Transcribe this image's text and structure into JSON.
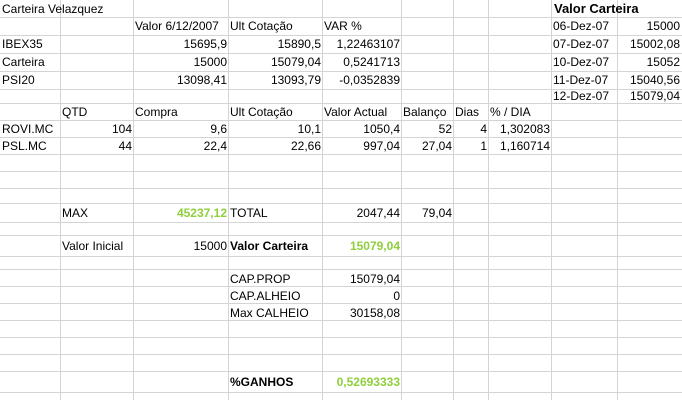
{
  "title": "Carteira Velazquez",
  "quotes": {
    "headers": [
      "Valor 6/12/2007",
      "Ult Cotação",
      "VAR %"
    ],
    "rows": [
      {
        "name": "IBEX35",
        "valor": "15695,9",
        "ult": "15890,5",
        "var": "1,22463107"
      },
      {
        "name": "Carteira",
        "valor": "15000",
        "ult": "15079,04",
        "var": "0,5241713"
      },
      {
        "name": "PSI20",
        "valor": "13098,41",
        "ult": "13093,79",
        "var": "-0,0352839"
      }
    ]
  },
  "valor_carteira_panel": {
    "title": "Valor Carteira",
    "rows": [
      {
        "date": "06-Dez-07",
        "value": "15000"
      },
      {
        "date": "07-Dez-07",
        "value": "15002,08"
      },
      {
        "date": "10-Dez-07",
        "value": "15052"
      },
      {
        "date": "11-Dez-07",
        "value": "15040,56"
      },
      {
        "date": "12-Dez-07",
        "value": "15079,04"
      }
    ]
  },
  "positions": {
    "headers": [
      "QTD",
      "Compra",
      "Ult Cotação",
      "Valor Actual",
      "Balanço",
      "Dias",
      "% / DIA"
    ],
    "rows": [
      {
        "name": "ROVI.MC",
        "qtd": "104",
        "compra": "9,6",
        "ult": "10,1",
        "valor": "1050,4",
        "balanco": "52",
        "dias": "4",
        "pct": "1,302083"
      },
      {
        "name": "PSL.MC",
        "qtd": "44",
        "compra": "22,4",
        "ult": "22,66",
        "valor": "997,04",
        "balanco": "27,04",
        "dias": "1",
        "pct": "1,160714"
      }
    ]
  },
  "summary": {
    "max_label": "MAX",
    "max_value": "45237,12",
    "total_label": "TOTAL",
    "total_value": "2047,44",
    "total_balanco": "79,04",
    "valor_inicial_label": "Valor Inicial",
    "valor_inicial_value": "15000",
    "valor_carteira_label": "Valor Carteira",
    "valor_carteira_value": "15079,04",
    "cap_prop_label": "CAP.PROP",
    "cap_prop_value": "15079,04",
    "cap_alheio_label": "CAP.ALHEIO",
    "cap_alheio_value": "0",
    "max_calheio_label": "Max CALHEIO",
    "max_calheio_value": "30158,08",
    "ganhos_label": "%GANHOS",
    "ganhos_value": "0,52693333"
  },
  "colors": {
    "grid": "#d4d4d4",
    "highlight_green": "#8fce3c"
  }
}
